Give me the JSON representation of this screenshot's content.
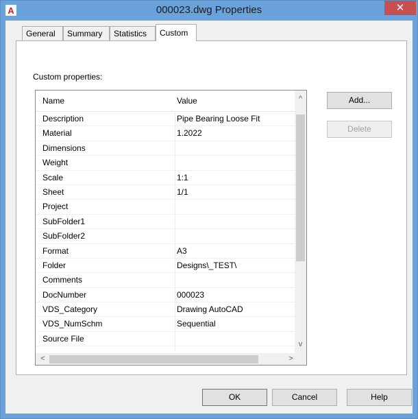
{
  "window": {
    "title": "000023.dwg Properties",
    "close_glyph": "✕",
    "app_icon_letter": "A"
  },
  "tabs": [
    {
      "label": "General"
    },
    {
      "label": "Summary"
    },
    {
      "label": "Statistics"
    },
    {
      "label": "Custom",
      "active": true
    }
  ],
  "panel": {
    "label": "Custom properties:"
  },
  "grid": {
    "columns": [
      "Name",
      "Value"
    ],
    "rows": [
      {
        "name": "Description",
        "value": "Pipe Bearing Loose Fit"
      },
      {
        "name": "Material",
        "value": "1.2022"
      },
      {
        "name": "Dimensions",
        "value": ""
      },
      {
        "name": "Weight",
        "value": ""
      },
      {
        "name": "Scale",
        "value": "1:1"
      },
      {
        "name": "Sheet",
        "value": "1/1"
      },
      {
        "name": "Project",
        "value": ""
      },
      {
        "name": "SubFolder1",
        "value": ""
      },
      {
        "name": "SubFolder2",
        "value": ""
      },
      {
        "name": "Format",
        "value": "A3"
      },
      {
        "name": "Folder",
        "value": "Designs\\_TEST\\"
      },
      {
        "name": "Comments",
        "value": ""
      },
      {
        "name": "DocNumber",
        "value": "000023"
      },
      {
        "name": "VDS_Category",
        "value": "Drawing AutoCAD"
      },
      {
        "name": "VDS_NumSchm",
        "value": "Sequential"
      },
      {
        "name": "Source File",
        "value": ""
      }
    ],
    "scroll": {
      "up": "^",
      "down": "v",
      "left": "<",
      "right": ">"
    }
  },
  "side_buttons": {
    "add": "Add...",
    "delete": "Delete"
  },
  "footer_buttons": {
    "ok": "OK",
    "cancel": "Cancel",
    "help": "Help"
  },
  "colors": {
    "titlebar": "#6aa3dc",
    "close": "#c75050",
    "dialog_bg": "#f0f0f0"
  }
}
